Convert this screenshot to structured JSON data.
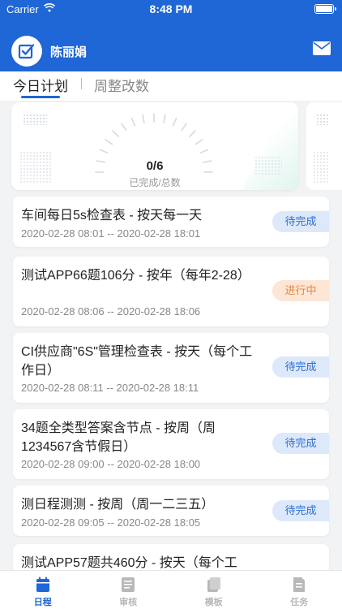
{
  "status_bar": {
    "carrier": "Carrier",
    "time": "8:48 PM"
  },
  "header": {
    "user_name": "陈丽娟",
    "mail_icon": "mail-icon",
    "avatar_icon": "checkbox-icon"
  },
  "tabs": [
    {
      "label": "今日计划",
      "active": true
    },
    {
      "label": "周整改数",
      "active": false
    }
  ],
  "summary": {
    "value": "0/6",
    "label": "已完成/总数",
    "completed": 0,
    "total": 6
  },
  "tasks": [
    {
      "title": "车间每日5s检查表 - 按天每一天",
      "time": "2020-02-28 08:01 -- 2020-02-28 18:01",
      "status": "待完成"
    },
    {
      "title": "测试APP66题106分 - 按年（每年2-28）",
      "time": "2020-02-28 08:06 -- 2020-02-28 18:06",
      "status": "进行中"
    },
    {
      "title": "CI供应商\"6S\"管理检查表 - 按天（每个工作日）",
      "time": "2020-02-28 08:11 -- 2020-02-28 18:11",
      "status": "待完成"
    },
    {
      "title": "34题全类型答案含节点 - 按周（周1234567含节假日）",
      "time": "2020-02-28 09:00 -- 2020-02-28 18:00",
      "status": "待完成"
    },
    {
      "title": "测日程测测 - 按周（周一二三五）",
      "time": "2020-02-28 09:05 -- 2020-02-28 18:05",
      "status": "待完成"
    },
    {
      "title": "测试APP57题共460分 - 按天（每个工",
      "time": "",
      "status": ""
    }
  ],
  "tabbar": [
    {
      "label": "日程",
      "icon": "calendar-icon",
      "active": true
    },
    {
      "label": "审核",
      "icon": "review-icon",
      "active": false
    },
    {
      "label": "模板",
      "icon": "template-icon",
      "active": false
    },
    {
      "label": "任务",
      "icon": "task-icon",
      "active": false
    }
  ],
  "colors": {
    "primary": "#1f66d6",
    "pending_bg": "#dde8fa",
    "pending_text": "#2a6ed8",
    "progress_bg": "#fde6d6",
    "progress_text": "#e58a3a",
    "inactive_tab": "#b8b8b8"
  }
}
